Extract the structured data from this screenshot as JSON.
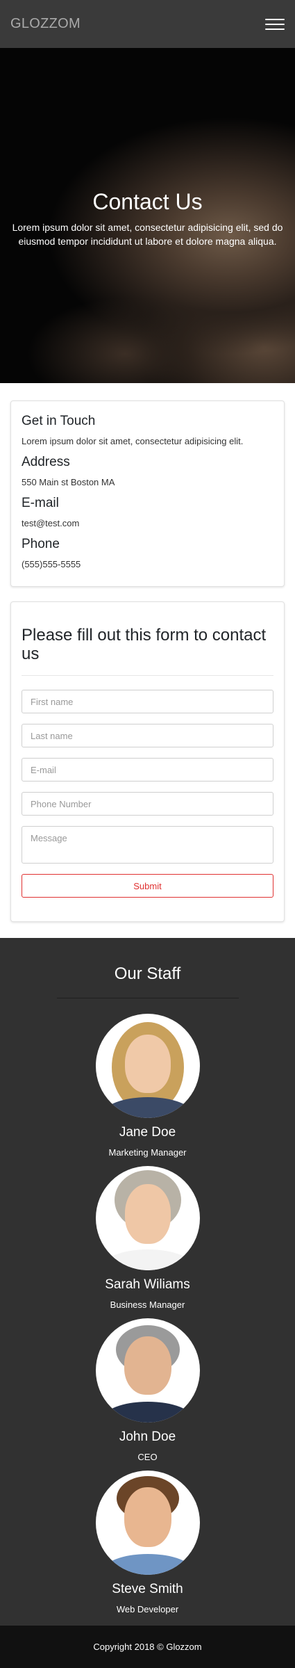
{
  "navbar": {
    "brand": "GLOZZOM",
    "menu_icon": "hamburger-menu-icon"
  },
  "hero": {
    "title": "Contact Us",
    "text": "Lorem ipsum dolor sit amet, consectetur adipisicing elit, sed do eiusmod tempor incididunt ut labore et dolore magna aliqua."
  },
  "contact_info": {
    "heading": "Get in Touch",
    "text": "Lorem ipsum dolor sit amet, consectetur adipisicing elit.",
    "address_heading": "Address",
    "address": "550 Main st Boston MA",
    "email_heading": "E-mail",
    "email": "test@test.com",
    "phone_heading": "Phone",
    "phone": "(555)555-5555"
  },
  "contact_form": {
    "heading": "Please fill out this form to contact us",
    "first_name_placeholder": "First name",
    "last_name_placeholder": "Last name",
    "email_placeholder": "E-mail",
    "phone_placeholder": "Phone Number",
    "message_placeholder": "Message",
    "submit_label": "Submit",
    "submit_color": "#e03131"
  },
  "staff": {
    "heading": "Our Staff",
    "members": [
      {
        "name": "Jane Doe",
        "role": "Marketing Manager"
      },
      {
        "name": "Sarah Wiliams",
        "role": "Business Manager"
      },
      {
        "name": "John Doe",
        "role": "CEO"
      },
      {
        "name": "Steve Smith",
        "role": "Web Developer"
      }
    ]
  },
  "footer": {
    "text": "Copyright 2018 © Glozzom"
  }
}
